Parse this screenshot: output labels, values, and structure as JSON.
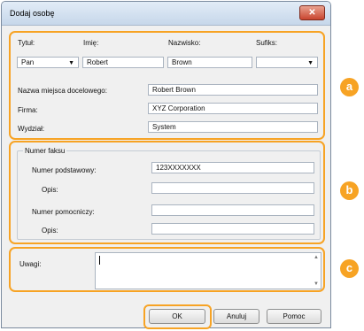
{
  "window": {
    "title": "Dodaj osobę",
    "close_glyph": "✕"
  },
  "name_section": {
    "tytul_label": "Tytuł:",
    "imie_label": "Imię:",
    "nazwisko_label": "Nazwisko:",
    "sufiks_label": "Sufiks:",
    "tytul_value": "Pan",
    "imie_value": "Robert",
    "nazwisko_value": "Brown",
    "sufiks_value": "",
    "dest_label": "Nazwa miejsca docelowego:",
    "dest_value": "Robert Brown",
    "firma_label": "Firma:",
    "firma_value": "XYZ Corporation",
    "wydzial_label": "Wydział:",
    "wydzial_value": "System"
  },
  "fax_section": {
    "group_label": "Numer faksu",
    "primary_label": "Numer podstawowy:",
    "primary_value": "123XXXXXXX",
    "opis1_label": "Opis:",
    "opis1_value": "",
    "secondary_label": "Numer pomocniczy:",
    "secondary_value": "",
    "opis2_label": "Opis:",
    "opis2_value": ""
  },
  "notes_section": {
    "label": "Uwagi:",
    "value": ""
  },
  "buttons": {
    "ok": "OK",
    "cancel": "Anuluj",
    "help": "Pomoc"
  },
  "markers": {
    "a": "a",
    "b": "b",
    "c": "c"
  },
  "icons": {
    "dropdown": "▼",
    "scroll_up": "▲",
    "scroll_down": "▼"
  },
  "colors": {
    "highlight": "#f7a324",
    "close_button": "#c9452f"
  }
}
